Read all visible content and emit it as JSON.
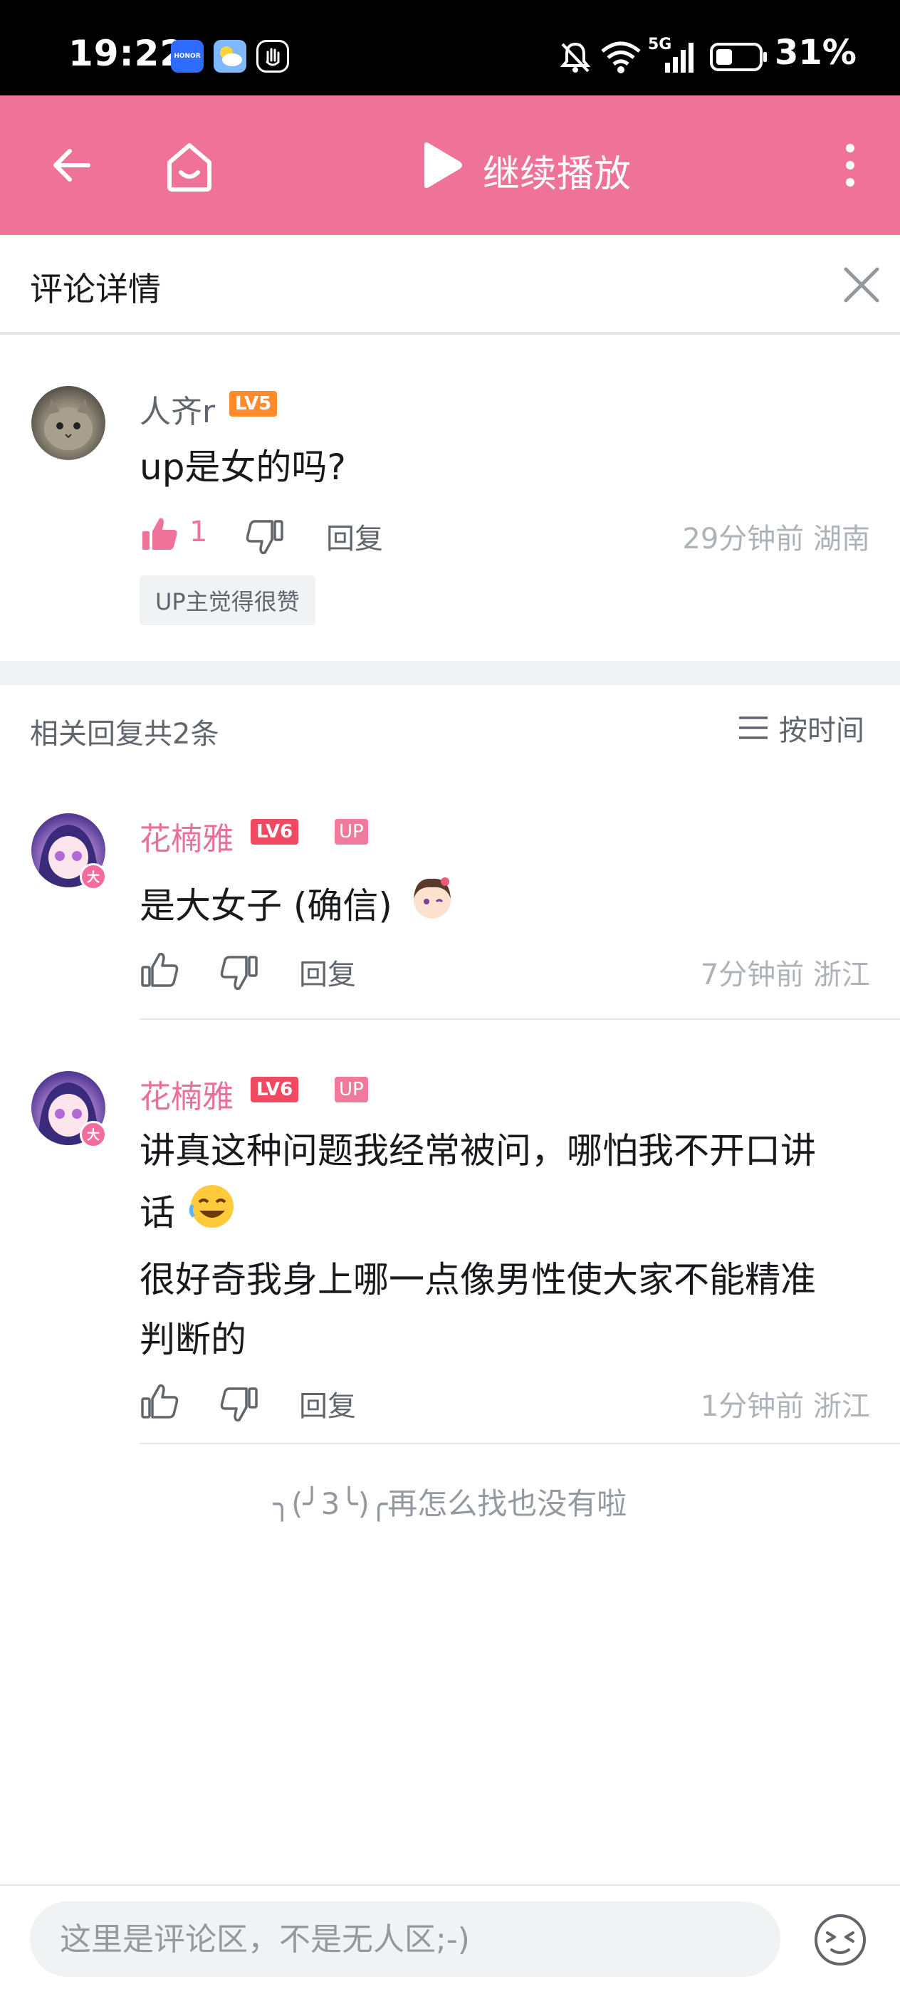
{
  "status_bar": {
    "time": "19:22",
    "battery": "31%",
    "network": "5G",
    "apps": [
      "honor-app",
      "weather-app",
      "gesture-app"
    ]
  },
  "header": {
    "title": "继续播放",
    "accent_color": "#ef7398"
  },
  "detail": {
    "title": "评论详情"
  },
  "root_comment": {
    "username": "人齐r",
    "level": "LV5",
    "text": "up是女的吗?",
    "likes": "1",
    "reply_label": "回复",
    "meta": "29分钟前 湖南",
    "tag": "UP主觉得很赞"
  },
  "replies_header": {
    "count_label": "相关回复共2条",
    "sort_label": "按时间"
  },
  "replies": [
    {
      "username": "花楠雅",
      "level": "LV6",
      "up_badge": "UP",
      "avatar_badge": "大",
      "text": "是大女子 (确信)",
      "reply_label": "回复",
      "meta": "7分钟前 浙江"
    },
    {
      "username": "花楠雅",
      "level": "LV6",
      "up_badge": "UP",
      "avatar_badge": "大",
      "text_line1": "讲真这种问题我经常被问，哪怕我不开口讲",
      "text_line2": "话",
      "text_line3": "很好奇我身上哪一点像男性使大家不能精准",
      "text_line4": "判断的",
      "reply_label": "回复",
      "meta": "1分钟前 浙江"
    }
  ],
  "end_message": "╮(╯3╰)╭再怎么找也没有啦",
  "input": {
    "placeholder": "这里是评论区，不是无人区;-)"
  }
}
